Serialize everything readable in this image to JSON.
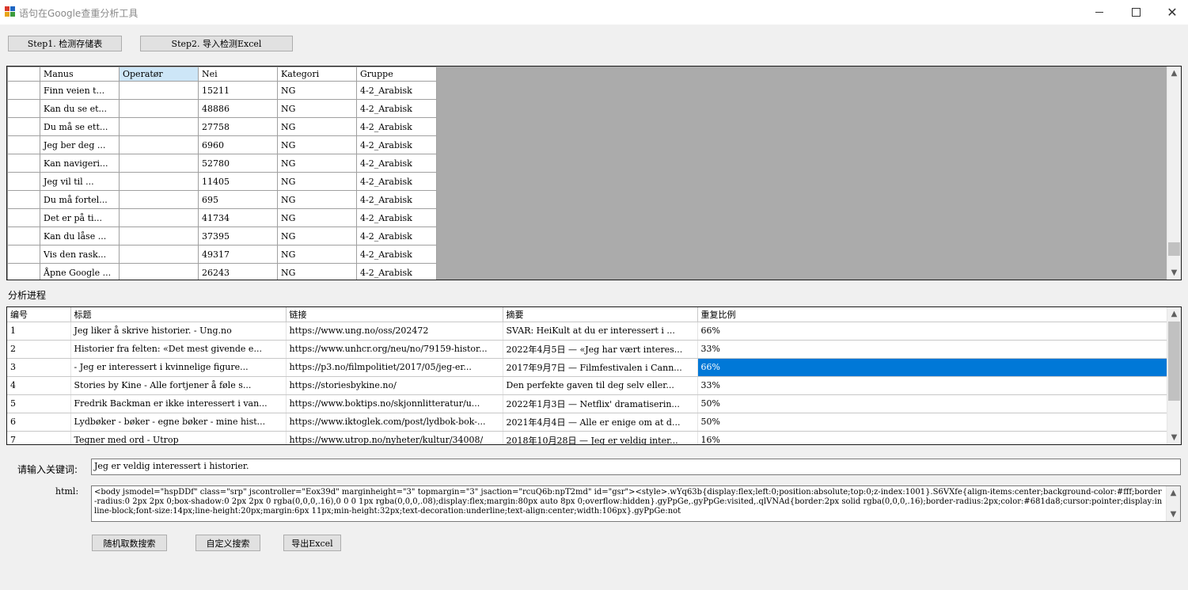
{
  "window": {
    "title": "语句在Google查重分析工具",
    "icon": "app-window-icon",
    "controls": {
      "minimize_icon": "minimize-icon",
      "maximize_icon": "maximize-icon",
      "close_glyph": "✕"
    }
  },
  "toolbar": {
    "step1_label": "Step1. 检测存储表",
    "step2_label": "Step2. 导入检测Excel"
  },
  "storage_grid": {
    "columns": [
      "",
      "Manus",
      "Operatør",
      "Nei",
      "Kategori",
      "Gruppe"
    ],
    "selected_column": "Operatør",
    "rows": [
      {
        "manus": "Finn veien t...",
        "operator": "",
        "nei": "15211",
        "kategori": "NG",
        "gruppe": "4-2_Arabisk"
      },
      {
        "manus": "Kan du se et...",
        "operator": "",
        "nei": "48886",
        "kategori": "NG",
        "gruppe": "4-2_Arabisk"
      },
      {
        "manus": "Du må se ett...",
        "operator": "",
        "nei": "27758",
        "kategori": "NG",
        "gruppe": "4-2_Arabisk"
      },
      {
        "manus": "Jeg ber deg ...",
        "operator": "",
        "nei": "6960",
        "kategori": "NG",
        "gruppe": "4-2_Arabisk"
      },
      {
        "manus": "Kan navigeri...",
        "operator": "",
        "nei": "52780",
        "kategori": "NG",
        "gruppe": "4-2_Arabisk"
      },
      {
        "manus": "Jeg vil til ...",
        "operator": "",
        "nei": "11405",
        "kategori": "NG",
        "gruppe": "4-2_Arabisk"
      },
      {
        "manus": "Du må fortel...",
        "operator": "",
        "nei": "695",
        "kategori": "NG",
        "gruppe": "4-2_Arabisk"
      },
      {
        "manus": "Det er på ti...",
        "operator": "",
        "nei": "41734",
        "kategori": "NG",
        "gruppe": "4-2_Arabisk"
      },
      {
        "manus": "Kan du låse ...",
        "operator": "",
        "nei": "37395",
        "kategori": "NG",
        "gruppe": "4-2_Arabisk"
      },
      {
        "manus": "Vis den rask...",
        "operator": "",
        "nei": "49317",
        "kategori": "NG",
        "gruppe": "4-2_Arabisk"
      },
      {
        "manus": "Åpne Google ...",
        "operator": "",
        "nei": "26243",
        "kategori": "NG",
        "gruppe": "4-2_Arabisk"
      }
    ]
  },
  "analysis": {
    "section_label": "分析进程",
    "columns": [
      "编号",
      "标题",
      "链接",
      "摘要",
      "重复比例"
    ],
    "selected_row_index": 2,
    "rows": [
      {
        "id": "1",
        "title": "Jeg liker å skrive historier. - Ung.no",
        "link": "https://www.ung.no/oss/202472",
        "summary": "SVAR: HeiKult at du er interessert i ...",
        "ratio": "66%"
      },
      {
        "id": "2",
        "title": "Historier fra felten: «Det mest givende e...",
        "link": "https://www.unhcr.org/neu/no/79159-histor...",
        "summary": "2022年4月5日 — «Jeg har vært interes...",
        "ratio": "33%"
      },
      {
        "id": "3",
        "title": "- Jeg er interessert i kvinnelige figure...",
        "link": "https://p3.no/filmpolitiet/2017/05/jeg-er...",
        "summary": "2017年9月7日 — Filmfestivalen i Cann...",
        "ratio": "66%"
      },
      {
        "id": "4",
        "title": "Stories by Kine - Alle fortjener å føle s...",
        "link": "https://storiesbykine.no/",
        "summary": "Den perfekte gaven til deg selv eller...",
        "ratio": "33%"
      },
      {
        "id": "5",
        "title": "Fredrik Backman er ikke interessert i van...",
        "link": "https://www.boktips.no/skjonnlitteratur/u...",
        "summary": "2022年1月3日 — Netflix' dramatiserin...",
        "ratio": "50%"
      },
      {
        "id": "6",
        "title": "Lydbøker - bøker - egne bøker - mine hist...",
        "link": "https://www.iktoglek.com/post/lydbok-bok-...",
        "summary": "2021年4月4日 — Alle er enige om at d...",
        "ratio": "50%"
      },
      {
        "id": "7",
        "title": "Tegner med ord - Utrop",
        "link": "https://www.utrop.no/nyheter/kultur/34008/",
        "summary": "2018年10月28日 — Jeg er veldig inter...",
        "ratio": "16%"
      }
    ]
  },
  "keyword": {
    "label": "请输入关键词:",
    "value": "Jeg er veldig interessert i historier."
  },
  "html_field": {
    "label": "html:",
    "value": "<body jsmodel=\"hspDDf\" class=\"srp\" jscontroller=\"Eox39d\" marginheight=\"3\" topmargin=\"3\" jsaction=\"rcuQ6b:npT2md\" id=\"gsr\"><style>.wYq63b{display:flex;left:0;position:absolute;top:0;z-index:1001}.S6VXfe{align-items:center;background-color:#fff;border-radius:0 2px 2px 0;box-shadow:0 2px 2px 0 rgba(0,0,0,.16),0 0 0 1px rgba(0,0,0,.08);display:flex;margin:80px auto 8px 0;overflow:hidden}.gyPpGe,.gyPpGe:visited,.qlVNAd{border:2px solid rgba(0,0,0,.16);border-radius:2px;color:#681da8;cursor:pointer;display:inline-block;font-size:14px;line-height:20px;margin:6px 11px;min-height:32px;text-decoration:underline;text-align:center;width:106px}.gyPpGe:not"
  },
  "actions": {
    "random_search_label": "随机取数搜索",
    "custom_search_label": "自定义搜索",
    "export_label": "导出Excel"
  },
  "colors": {
    "selection": "#0078d7",
    "header_selected": "#cde6f7",
    "grid_background": "#ababab"
  }
}
